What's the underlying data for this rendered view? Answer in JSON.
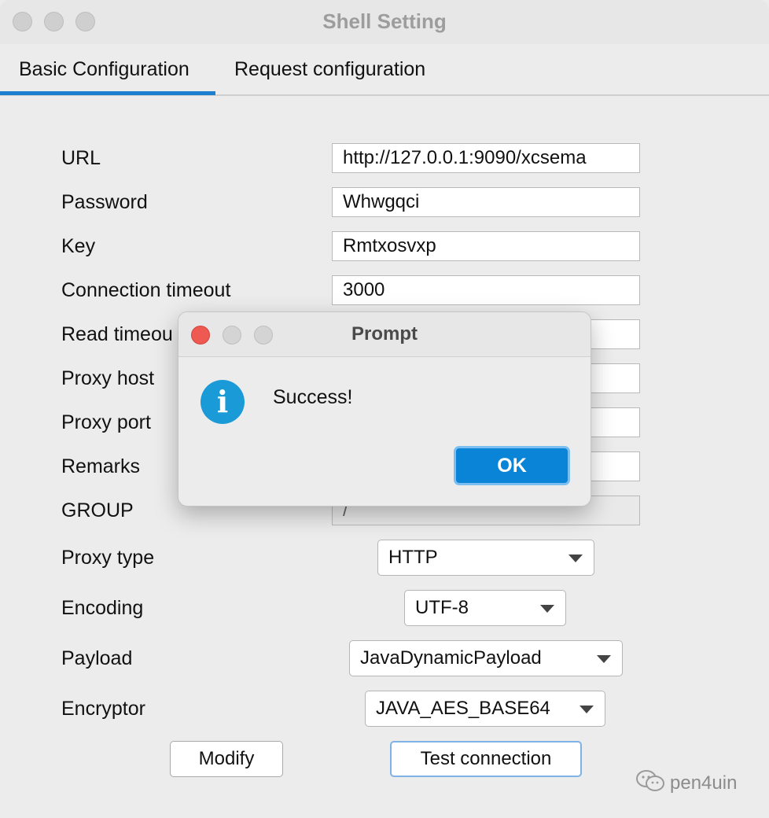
{
  "window": {
    "title": "Shell Setting"
  },
  "tabs": [
    {
      "label": "Basic Configuration",
      "active": true
    },
    {
      "label": "Request configuration",
      "active": false
    }
  ],
  "form": {
    "url": {
      "label": "URL",
      "value": "http://127.0.0.1:9090/xcsema"
    },
    "password": {
      "label": "Password",
      "value": "Whwgqci"
    },
    "key": {
      "label": "Key",
      "value": "Rmtxosvxp"
    },
    "connection_timeout": {
      "label": "Connection timeout",
      "value": "3000"
    },
    "read_timeout": {
      "label": "Read timeou",
      "value": ""
    },
    "proxy_host": {
      "label": "Proxy host",
      "value": ""
    },
    "proxy_port": {
      "label": "Proxy port",
      "value": ""
    },
    "remarks": {
      "label": "Remarks",
      "value": ""
    },
    "group": {
      "label": "GROUP",
      "value": "/"
    },
    "proxy_type": {
      "label": "Proxy type",
      "value": "HTTP"
    },
    "encoding": {
      "label": "Encoding",
      "value": "UTF-8"
    },
    "payload": {
      "label": "Payload",
      "value": "JavaDynamicPayload"
    },
    "encryptor": {
      "label": "Encryptor",
      "value": "JAVA_AES_BASE64"
    }
  },
  "buttons": {
    "modify": "Modify",
    "test_connection": "Test connection"
  },
  "dialog": {
    "title": "Prompt",
    "message": "Success!",
    "ok": "OK",
    "icon": "info-icon"
  },
  "watermark": {
    "text": "pen4uin"
  },
  "colors": {
    "accent": "#1d7fd0",
    "ok_button": "#0a84d6",
    "info_icon": "#1a9bd7",
    "close_red": "#ee5a52"
  }
}
